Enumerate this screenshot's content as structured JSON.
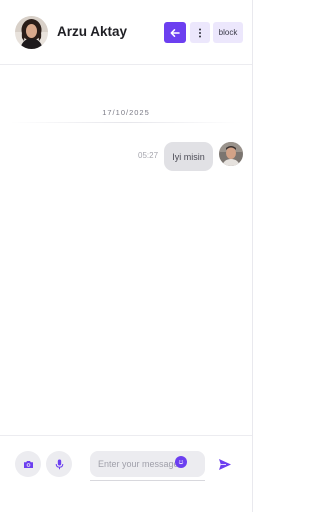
{
  "header": {
    "contact_name": "Arzu Aktay",
    "block_label": "block",
    "icons": {
      "back": "arrow-left-icon",
      "more": "more-vertical-icon"
    }
  },
  "messages": {
    "date_separator": "17/10/2025",
    "items": [
      {
        "text": "Iyi misin",
        "time": "05:27",
        "direction": "outgoing"
      }
    ]
  },
  "composer": {
    "placeholder": "Enter your message",
    "icons": {
      "camera": "camera-icon",
      "mic": "microphone-icon",
      "emoji": "smiley-icon",
      "send": "send-icon"
    }
  },
  "colors": {
    "accent": "#6c3ff0",
    "accent_light": "#ece7fc",
    "bubble": "#e1e1e5",
    "field_bg": "#ececf0"
  }
}
